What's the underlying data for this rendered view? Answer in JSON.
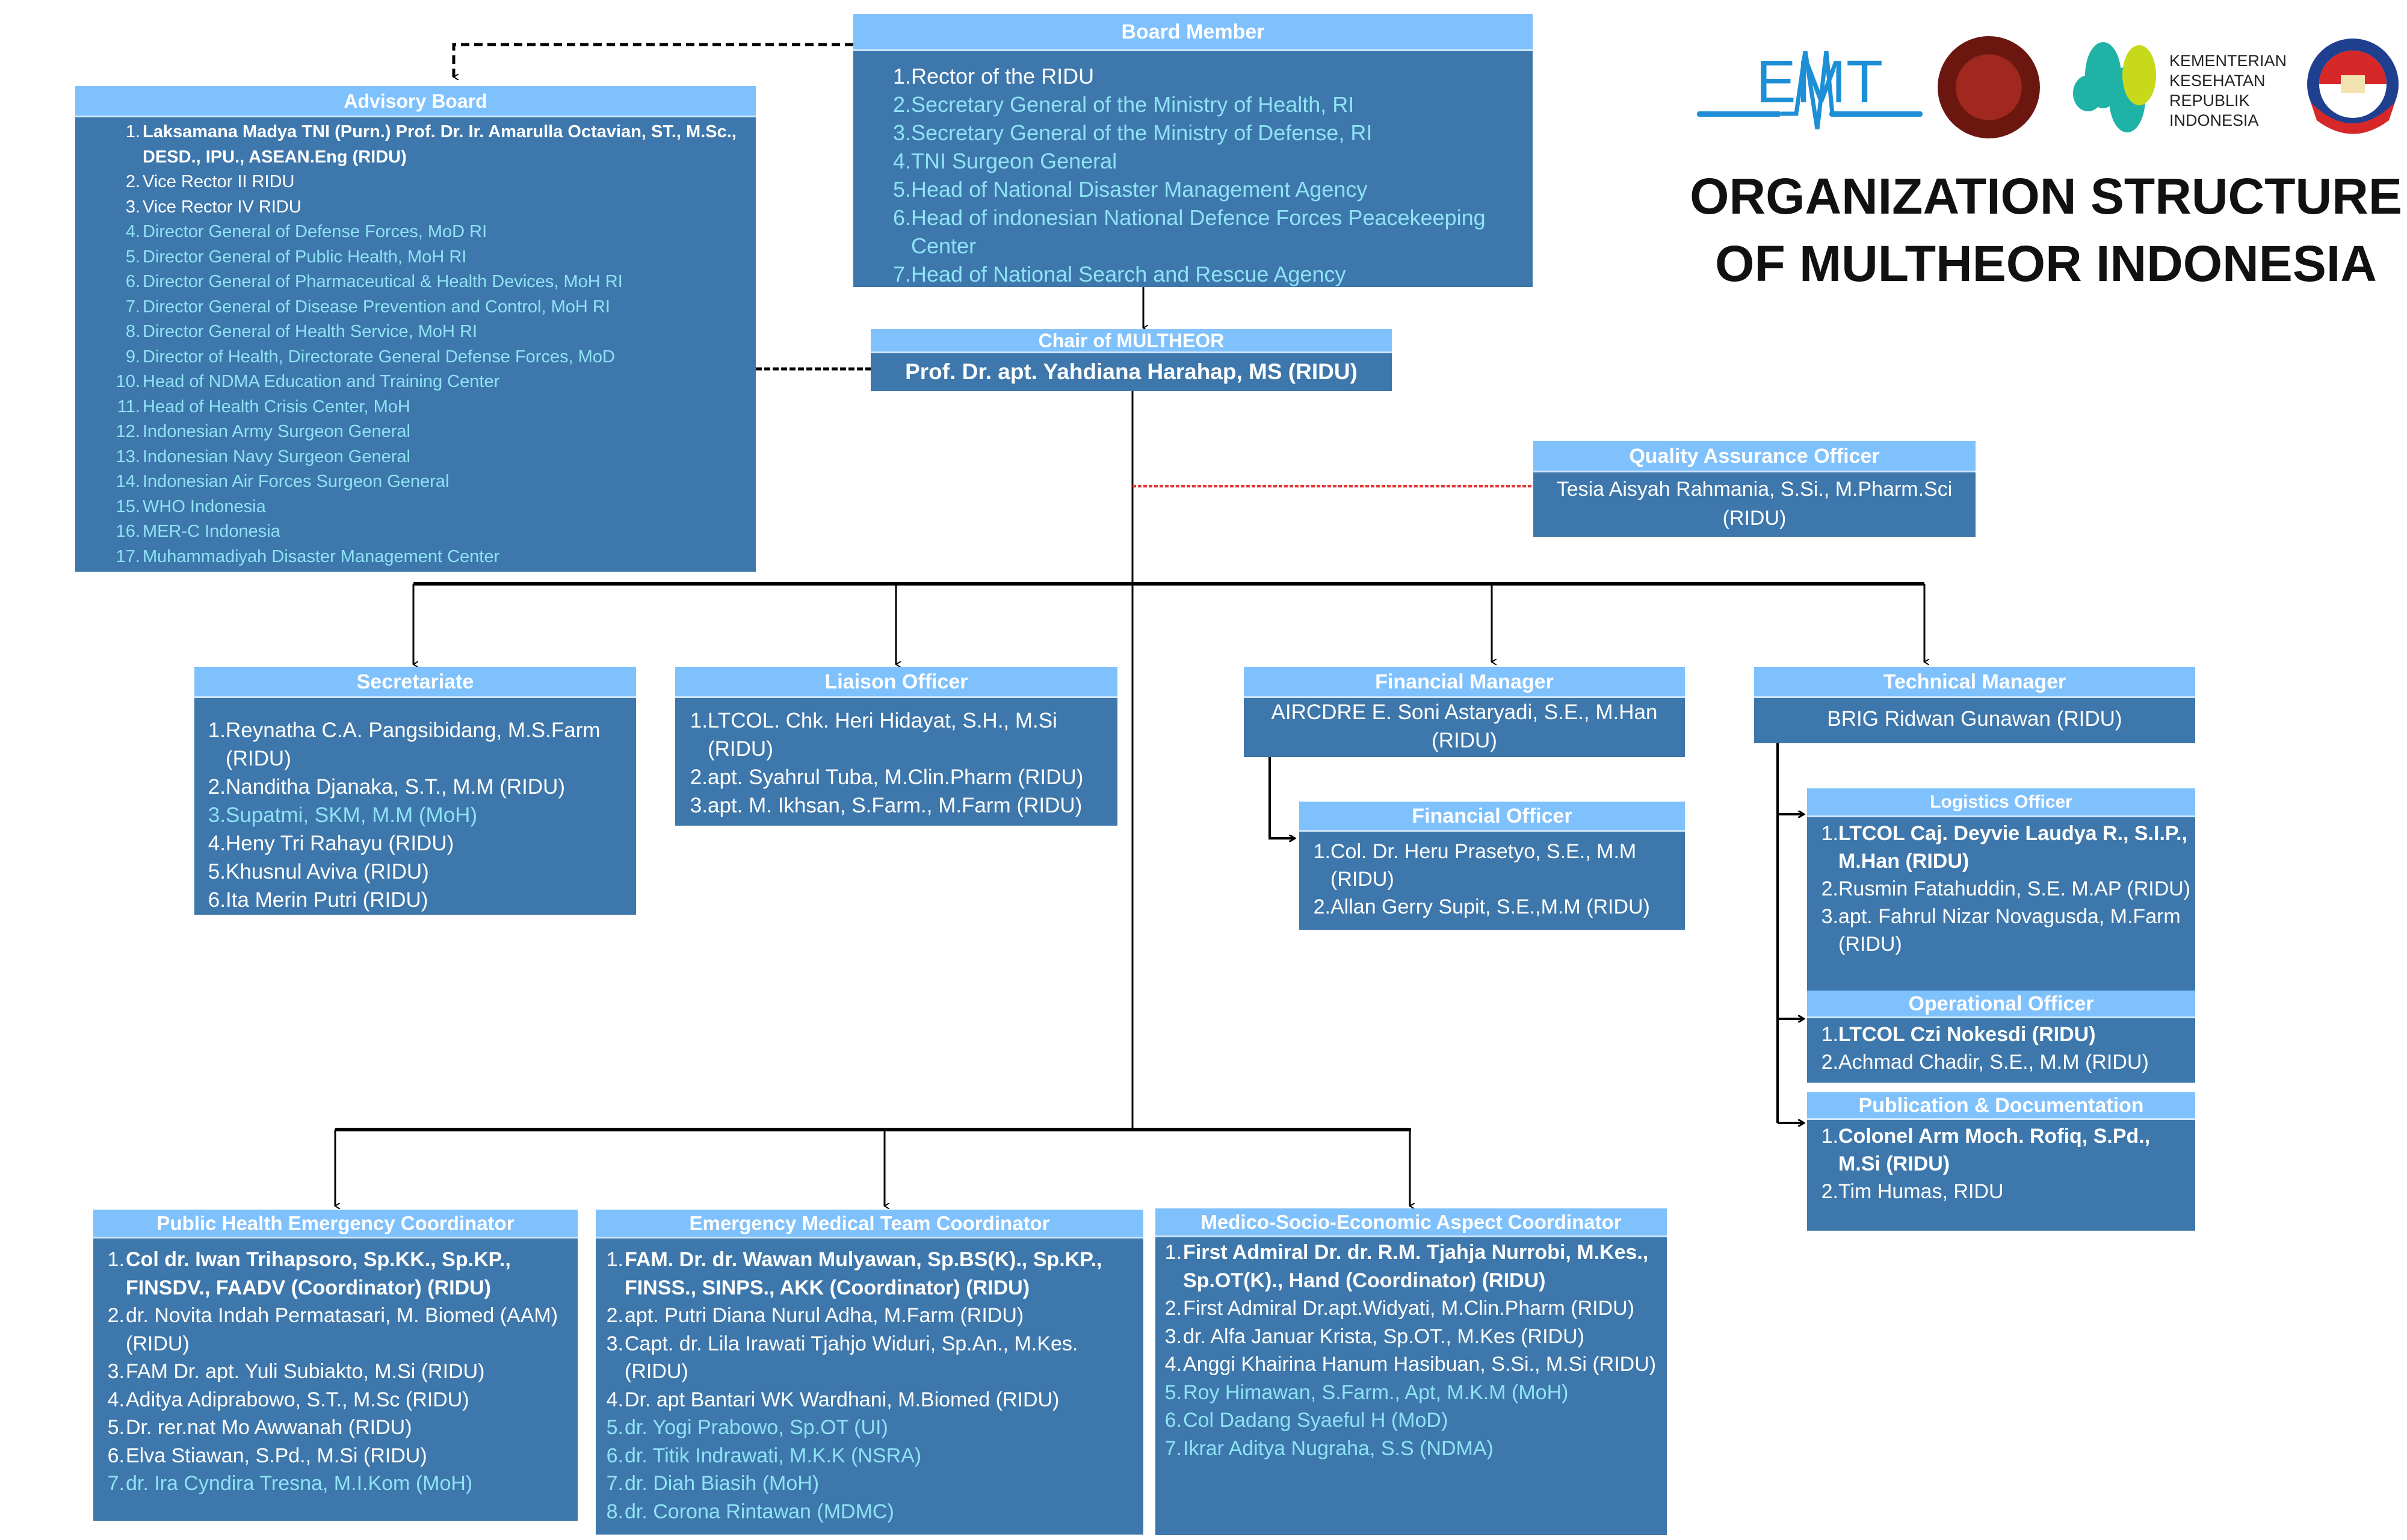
{
  "title": {
    "line1": "ORGANIZATION STRUCTURE",
    "line2": "OF MULTHEOR INDONESIA"
  },
  "logos": {
    "emt": "EMT",
    "kemenkes_lines": [
      "KEMENTERIAN",
      "KESEHATAN",
      "REPUBLIK",
      "INDONESIA"
    ],
    "kemhan": "KEMENTERIAN PERTAHANAN REPUBLIK INDONESIA",
    "unhan": "UNIVERSITAS PERTAHANAN REPUBLIK INDONESIA"
  },
  "colors": {
    "header": "#7fc1fd",
    "body": "#3d77ab",
    "text_primary": "#ffffff",
    "text_external": "#8ee3f6",
    "qa_link": "#e53935"
  },
  "board": {
    "title": "Board Member",
    "items": [
      {
        "n": "1.",
        "t": "Rector of the RIDU",
        "ext": false,
        "bold": false
      },
      {
        "n": "2.",
        "t": "Secretary General of the Ministry of Health, RI",
        "ext": true,
        "bold": false
      },
      {
        "n": "3.",
        "t": "Secretary General of the Ministry of Defense, RI",
        "ext": true,
        "bold": false
      },
      {
        "n": "4.",
        "t": "TNI Surgeon General",
        "ext": true,
        "bold": false
      },
      {
        "n": "5.",
        "t": "Head of National Disaster Management Agency",
        "ext": true,
        "bold": false
      },
      {
        "n": "6.",
        "t": "Head of indonesian National Defence Forces Peacekeeping Center",
        "ext": true,
        "bold": false
      },
      {
        "n": "7.",
        "t": "Head of National Search and Rescue Agency",
        "ext": true,
        "bold": false
      }
    ]
  },
  "advisory": {
    "title": "Advisory Board",
    "items": [
      {
        "n": "1.",
        "t": "Laksamana Madya TNI (Purn.) Prof. Dr. Ir. Amarulla Octavian, ST., M.Sc., DESD., IPU., ASEAN.Eng (RIDU)",
        "ext": false,
        "bold": true
      },
      {
        "n": "2.",
        "t": "Vice Rector II RIDU",
        "ext": false,
        "bold": false
      },
      {
        "n": "3.",
        "t": "Vice Rector IV RIDU",
        "ext": false,
        "bold": false
      },
      {
        "n": "4.",
        "t": "Director General of Defense Forces, MoD RI",
        "ext": true,
        "bold": false
      },
      {
        "n": "5.",
        "t": "Director General of Public Health, MoH RI",
        "ext": true,
        "bold": false
      },
      {
        "n": "6.",
        "t": "Director General of Pharmaceutical & Health Devices, MoH RI",
        "ext": true,
        "bold": false
      },
      {
        "n": "7.",
        "t": "Director General of Disease Prevention and Control, MoH RI",
        "ext": true,
        "bold": false
      },
      {
        "n": "8.",
        "t": "Director General of Health Service, MoH RI",
        "ext": true,
        "bold": false
      },
      {
        "n": "9.",
        "t": "Director of Health, Directorate General Defense Forces, MoD",
        "ext": true,
        "bold": false
      },
      {
        "n": "10.",
        "t": "Head of NDMA Education and Training Center",
        "ext": true,
        "bold": false
      },
      {
        "n": "11.",
        "t": "Head of Health Crisis Center, MoH",
        "ext": true,
        "bold": false
      },
      {
        "n": "12.",
        "t": "Indonesian Army Surgeon General",
        "ext": true,
        "bold": false
      },
      {
        "n": "13.",
        "t": "Indonesian Navy Surgeon General",
        "ext": true,
        "bold": false
      },
      {
        "n": "14.",
        "t": "Indonesian Air Forces Surgeon General",
        "ext": true,
        "bold": false
      },
      {
        "n": "15.",
        "t": "WHO Indonesia",
        "ext": true,
        "bold": false
      },
      {
        "n": "16.",
        "t": "MER-C Indonesia",
        "ext": true,
        "bold": false
      },
      {
        "n": "17.",
        "t": "Muhammadiyah Disaster Management Center",
        "ext": true,
        "bold": false
      }
    ]
  },
  "chair": {
    "title": "Chair of MULTHEOR",
    "name": "Prof. Dr. apt. Yahdiana Harahap, MS (RIDU)"
  },
  "qa": {
    "title": "Quality Assurance Officer",
    "name": "Tesia Aisyah Rahmania, S.Si., M.Pharm.Sci (RIDU)"
  },
  "secretariate": {
    "title": "Secretariate",
    "items": [
      {
        "n": "1.",
        "t": "Reynatha C.A. Pangsibidang, M.S.Farm (RIDU)",
        "ext": false,
        "bold": false
      },
      {
        "n": "2.",
        "t": "Nanditha Djanaka, S.T., M.M (RIDU)",
        "ext": false,
        "bold": false
      },
      {
        "n": "3.",
        "t": "Supatmi, SKM, M.M (MoH)",
        "ext": true,
        "bold": false
      },
      {
        "n": "4.",
        "t": "Heny Tri Rahayu (RIDU)",
        "ext": false,
        "bold": false
      },
      {
        "n": "5.",
        "t": "Khusnul Aviva (RIDU)",
        "ext": false,
        "bold": false
      },
      {
        "n": "6.",
        "t": "Ita Merin Putri (RIDU)",
        "ext": false,
        "bold": false
      }
    ]
  },
  "liaison": {
    "title": "Liaison Officer",
    "items": [
      {
        "n": "1.",
        "t": "LTCOL. Chk. Heri Hidayat, S.H., M.Si (RIDU)",
        "ext": false,
        "bold": false
      },
      {
        "n": "2.",
        "t": "apt. Syahrul Tuba, M.Clin.Pharm (RIDU)",
        "ext": false,
        "bold": false
      },
      {
        "n": "3.",
        "t": "apt. M. Ikhsan, S.Farm., M.Farm (RIDU)",
        "ext": false,
        "bold": false
      }
    ]
  },
  "financial_manager": {
    "title": "Financial Manager",
    "name": "AIRCDRE E. Soni Astaryadi, S.E., M.Han (RIDU)"
  },
  "technical_manager": {
    "title": "Technical Manager",
    "name": "BRIG Ridwan Gunawan (RIDU)"
  },
  "financial_officer": {
    "title": "Financial Officer",
    "items": [
      {
        "n": "1.",
        "t": "Col. Dr. Heru Prasetyo, S.E., M.M (RIDU)",
        "ext": false,
        "bold": false
      },
      {
        "n": "2.",
        "t": "Allan Gerry Supit, S.E.,M.M (RIDU)",
        "ext": false,
        "bold": false
      }
    ]
  },
  "logistics": {
    "title": "Logistics Officer",
    "items": [
      {
        "n": "1.",
        "t": "LTCOL Caj. Deyvie Laudya R., S.I.P., M.Han (RIDU)",
        "ext": false,
        "bold": true
      },
      {
        "n": "2.",
        "t": "Rusmin Fatahuddin, S.E. M.AP (RIDU)",
        "ext": false,
        "bold": false
      },
      {
        "n": "3.",
        "t": "apt. Fahrul Nizar Novagusda, M.Farm (RIDU)",
        "ext": false,
        "bold": false
      }
    ]
  },
  "operational": {
    "title": "Operational Officer",
    "items": [
      {
        "n": "1.",
        "t": "LTCOL Czi Nokesdi (RIDU)",
        "ext": false,
        "bold": true
      },
      {
        "n": "2.",
        "t": "Achmad Chadir, S.E., M.M (RIDU)",
        "ext": false,
        "bold": false
      }
    ]
  },
  "publication": {
    "title": "Publication & Documentation",
    "items": [
      {
        "n": "1.",
        "t": "Colonel Arm Moch. Rofiq, S.Pd., M.Si (RIDU)",
        "ext": false,
        "bold": true
      },
      {
        "n": "2.",
        "t": "Tim Humas, RIDU",
        "ext": false,
        "bold": false
      }
    ]
  },
  "public_health": {
    "title": "Public Health Emergency Coordinator",
    "items": [
      {
        "n": "1.",
        "t": "Col dr. Iwan Trihapsoro, Sp.KK., Sp.KP., FINSDV., FAADV (Coordinator) (RIDU)",
        "ext": false,
        "bold": true
      },
      {
        "n": "2.",
        "t": "dr. Novita Indah Permatasari, M. Biomed (AAM)  (RIDU)",
        "ext": false,
        "bold": false
      },
      {
        "n": "3.",
        "t": "FAM Dr. apt. Yuli Subiakto, M.Si (RIDU)",
        "ext": false,
        "bold": false
      },
      {
        "n": "4.",
        "t": "Aditya Adiprabowo, S.T., M.Sc (RIDU)",
        "ext": false,
        "bold": false
      },
      {
        "n": "5.",
        "t": "Dr. rer.nat Mo Awwanah (RIDU)",
        "ext": false,
        "bold": false
      },
      {
        "n": "6.",
        "t": "Elva Stiawan, S.Pd., M.Si (RIDU)",
        "ext": false,
        "bold": false
      },
      {
        "n": "7.",
        "t": "dr. Ira Cyndira Tresna, M.I.Kom (MoH)",
        "ext": true,
        "bold": false
      }
    ]
  },
  "emt_coord": {
    "title": "Emergency Medical Team Coordinator",
    "items": [
      {
        "n": "1.",
        "t": "FAM. Dr. dr. Wawan Mulyawan, Sp.BS(K)., Sp.KP., FINSS., SINPS., AKK (Coordinator) (RIDU)",
        "ext": false,
        "bold": true
      },
      {
        "n": "2.",
        "t": "apt. Putri Diana Nurul Adha, M.Farm (RIDU)",
        "ext": false,
        "bold": false
      },
      {
        "n": "3.",
        "t": "Capt. dr. Lila Irawati Tjahjo Widuri, Sp.An., M.Kes. (RIDU)",
        "ext": false,
        "bold": false
      },
      {
        "n": "4.",
        "t": "Dr. apt Bantari WK Wardhani, M.Biomed (RIDU)",
        "ext": false,
        "bold": false
      },
      {
        "n": "5.",
        "t": "dr. Yogi Prabowo, Sp.OT (UI)",
        "ext": true,
        "bold": false
      },
      {
        "n": "6.",
        "t": "dr. Titik Indrawati, M.K.K (NSRA)",
        "ext": true,
        "bold": false
      },
      {
        "n": "7.",
        "t": "dr. Diah Biasih (MoH)",
        "ext": true,
        "bold": false
      },
      {
        "n": "8.",
        "t": "dr. Corona Rintawan (MDMC)",
        "ext": true,
        "bold": false
      }
    ]
  },
  "medico": {
    "title": "Medico-Socio-Economic Aspect Coordinator",
    "items": [
      {
        "n": "1.",
        "t": "First Admiral Dr. dr. R.M. Tjahja Nurrobi, M.Kes., Sp.OT(K)., Hand (Coordinator) (RIDU)",
        "ext": false,
        "bold": true
      },
      {
        "n": "2.",
        "t": "First Admiral Dr.apt.Widyati, M.Clin.Pharm (RIDU)",
        "ext": false,
        "bold": false
      },
      {
        "n": "3.",
        "t": "dr. Alfa Januar Krista, Sp.OT., M.Kes (RIDU)",
        "ext": false,
        "bold": false
      },
      {
        "n": "4.",
        "t": "Anggi Khairina Hanum Hasibuan, S.Si., M.Si (RIDU)",
        "ext": false,
        "bold": false
      },
      {
        "n": "5.",
        "t": "Roy Himawan, S.Farm., Apt, M.K.M (MoH)",
        "ext": true,
        "bold": false
      },
      {
        "n": "6.",
        "t": "Col Dadang Syaeful H (MoD)",
        "ext": true,
        "bold": false
      },
      {
        "n": "7.",
        "t": "Ikrar Aditya Nugraha, S.S (NDMA)",
        "ext": true,
        "bold": false
      }
    ]
  }
}
